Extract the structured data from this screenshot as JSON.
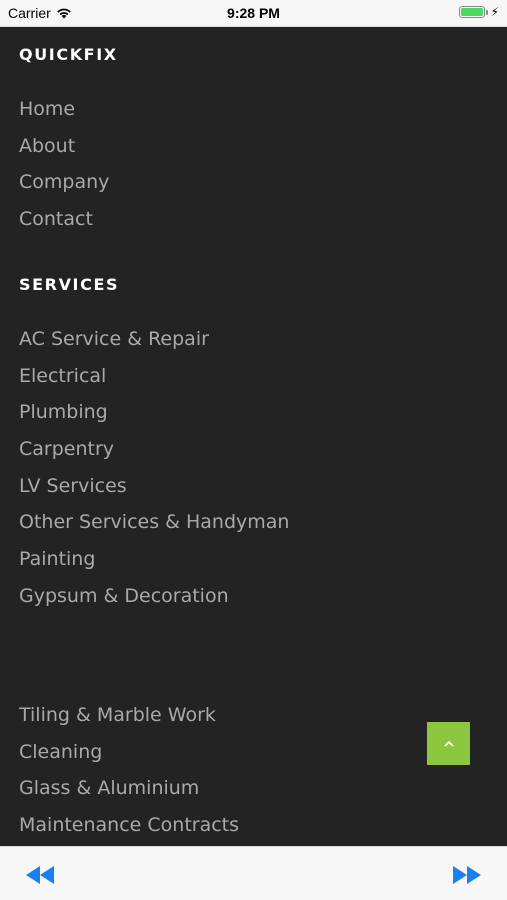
{
  "status_bar": {
    "carrier": "Carrier",
    "time": "9:28 PM",
    "icons": [
      "wifi-icon",
      "battery-icon",
      "charging-bolt-icon"
    ]
  },
  "footer_menu": {
    "quickfix": {
      "title": "QUICKFIX",
      "links": [
        "Home",
        "About",
        "Company",
        "Contact"
      ]
    },
    "services": {
      "title": "SERVICES",
      "links": [
        "AC Service & Repair",
        "Electrical",
        "Plumbing",
        "Carpentry",
        "LV Services",
        "Other Services & Handyman",
        "Painting",
        "Gypsum & Decoration"
      ],
      "more_links": [
        "Tiling & Marble Work",
        "Cleaning",
        "Glass & Aluminium",
        "Maintenance Contracts"
      ]
    }
  },
  "scroll_top_button": {
    "icon": "chevron-up-icon"
  },
  "toolbar": {
    "back_icon": "rewind-icon",
    "forward_icon": "fast-forward-icon"
  },
  "colors": {
    "background": "#232323",
    "heading": "#ffffff",
    "link": "#a9a9a9",
    "accent": "#8cc63f",
    "toolbar_icon": "#1a7ff0",
    "battery": "#4cd964"
  }
}
